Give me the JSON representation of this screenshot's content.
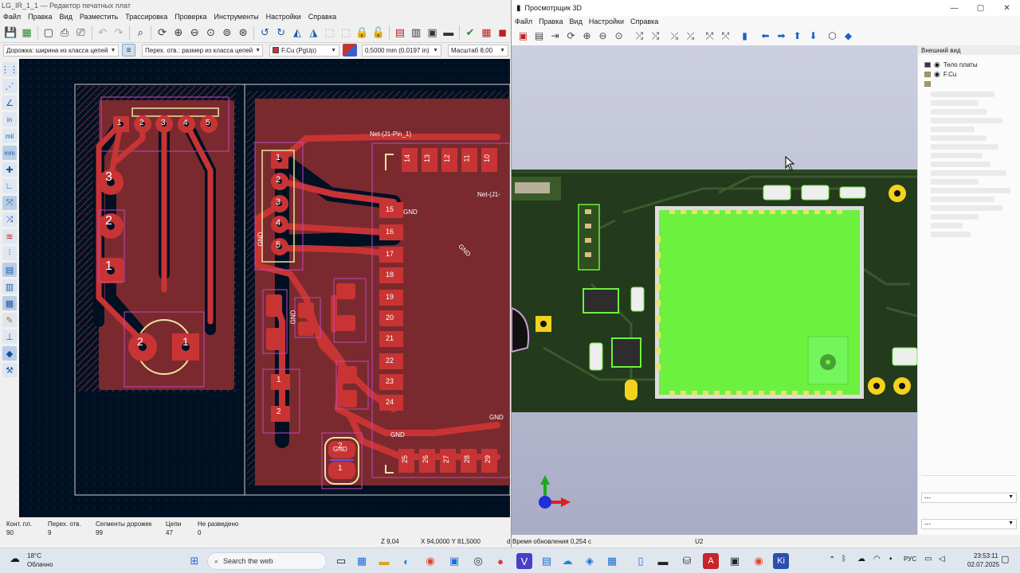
{
  "pcb_editor": {
    "title": "LG_IR_1_1 — Редактор печатных плат",
    "menu": [
      "Файл",
      "Правка",
      "Вид",
      "Разместить",
      "Трассировка",
      "Проверка",
      "Инструменты",
      "Настройки",
      "Справка"
    ],
    "options": {
      "track_width": "Дорожка: ширина из класса цепей",
      "via_size": "Перех. отв.: размер из класса цепей",
      "layer": "F.Cu (PgUp)",
      "grid": "0,5000 mm (0,0197 in)",
      "zoom": "Масштаб 8,00"
    },
    "canvas_labels": {
      "net_j1_pin1": "Net-(J1-Pin_1)",
      "net_j1_short": "Net-(J1-",
      "gnd": "GND",
      "pads_top": [
        "14",
        "13",
        "12",
        "11",
        "10"
      ],
      "pads_left": [
        "15",
        "16",
        "17",
        "18",
        "19",
        "20",
        "21",
        "22",
        "23",
        "24"
      ],
      "pads_bottom": [
        "25",
        "26",
        "27",
        "28",
        "29"
      ],
      "connector_top": [
        "1",
        "2",
        "3",
        "4",
        "5"
      ],
      "connector_left": [
        "3",
        "2",
        "1"
      ],
      "connector_mid": [
        "1",
        "2",
        "3",
        "4",
        "5"
      ],
      "sensor": [
        "2",
        "1"
      ],
      "small_pads": [
        "1",
        "2"
      ],
      "bottom_part": [
        "2",
        "1"
      ]
    },
    "status": {
      "pads_label": "Конт. пл.",
      "pads_value": "90",
      "vias_label": "Перех. отв.",
      "vias_value": "9",
      "segments_label": "Сегменты дорожек",
      "segments_value": "99",
      "nets_label": "Цепи",
      "nets_value": "47",
      "unrouted_label": "Не разведено",
      "unrouted_value": "0",
      "zoom_readout": "Z 9,04",
      "coords": "X 94,0000  Y 81,5000",
      "d_prefix": "d"
    }
  },
  "viewer3d": {
    "title": "Просмотрщик 3D",
    "menu": [
      "Файл",
      "Правка",
      "Вид",
      "Настройки",
      "Справка"
    ],
    "appearance_title": "Внешний вид",
    "layers": [
      {
        "name": "Тело платы",
        "color": "#3a3a3a"
      },
      {
        "name": "F.Cu",
        "color": "#b89a2c"
      },
      {
        "name": "",
        "color": "#b89a2c"
      }
    ],
    "combo1": "---",
    "combo2": "---",
    "status_time": "Время обновления 0,254 с",
    "status_ref": "U2"
  },
  "taskbar": {
    "weather_temp": "18°C",
    "weather_desc": "Облачно",
    "search_placeholder": "Search the web",
    "lang": "РУС",
    "time": "23:53:11",
    "date": "02.07.2025"
  }
}
